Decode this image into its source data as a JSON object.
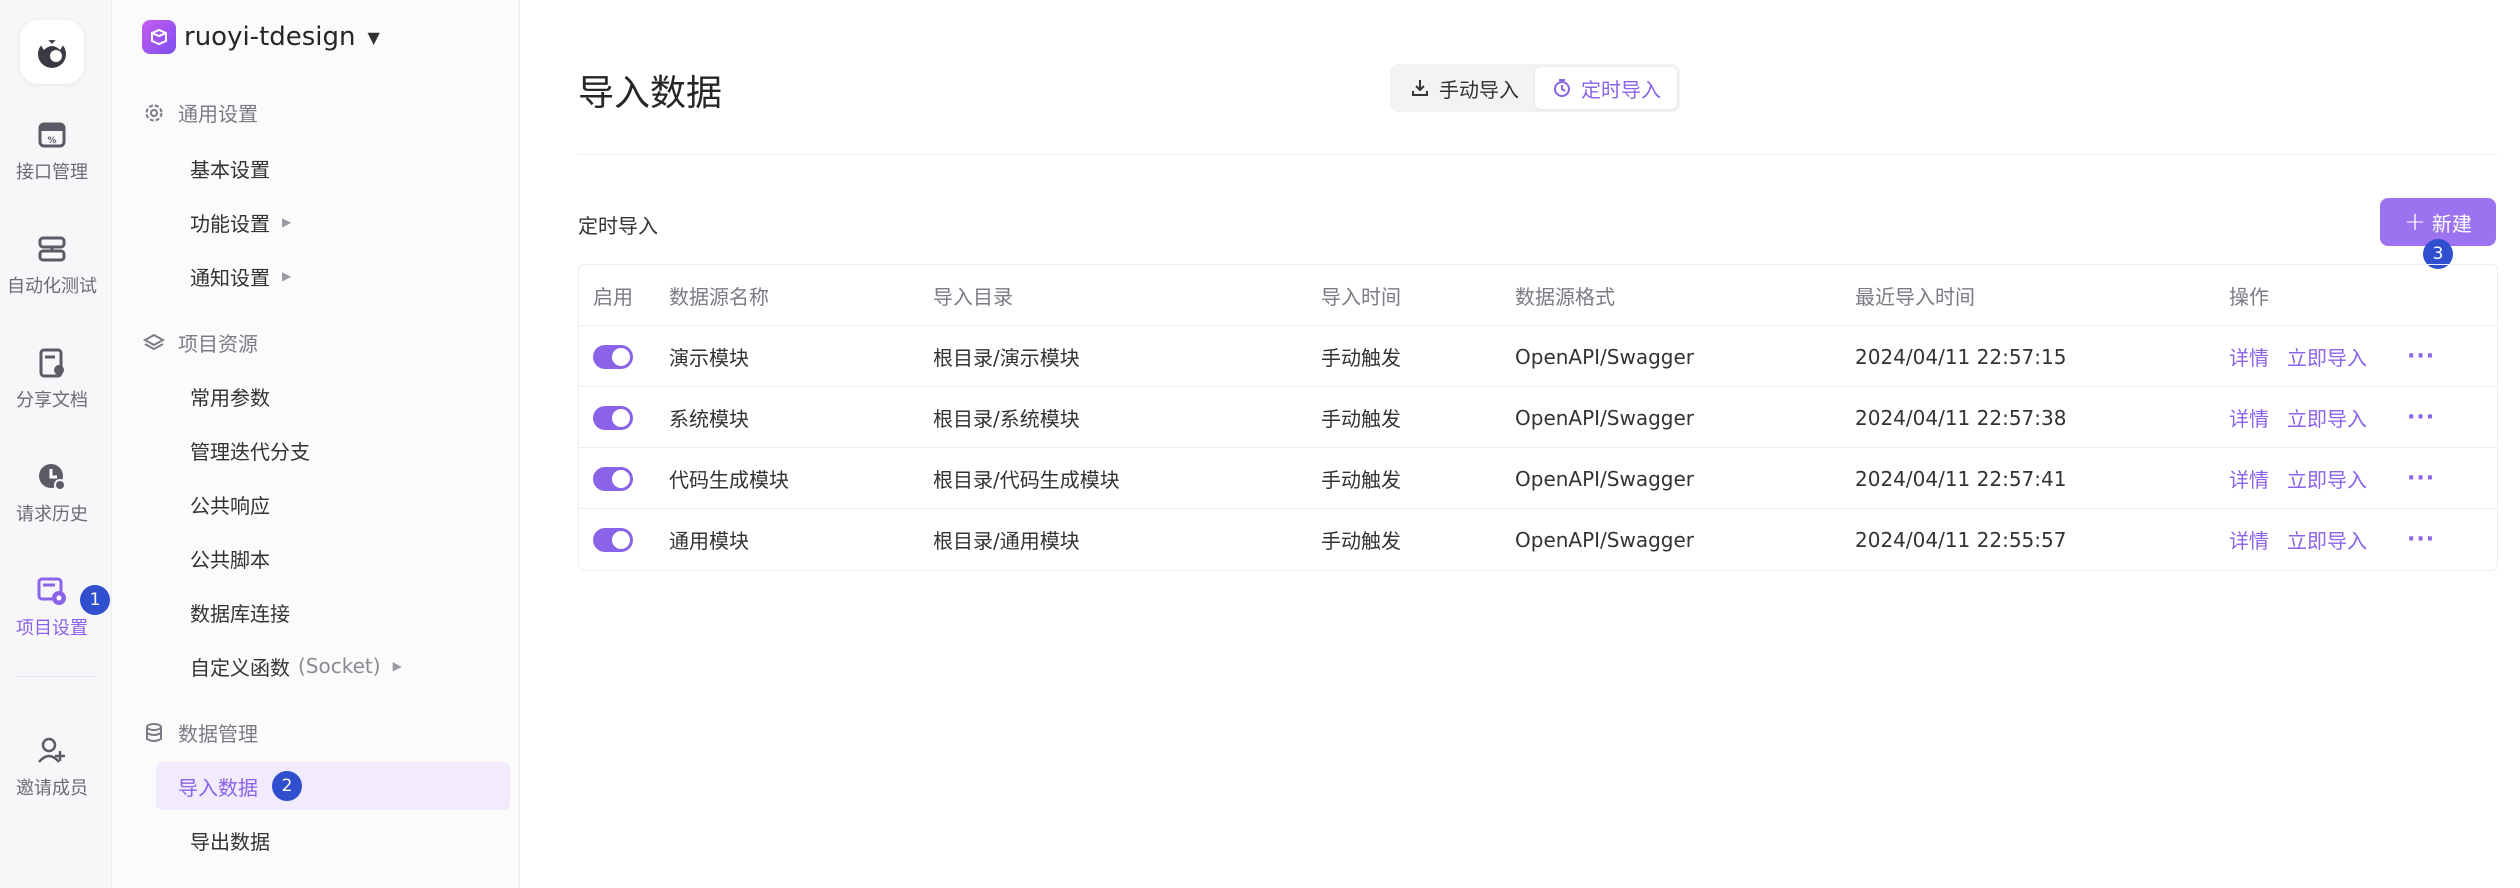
{
  "rail": {
    "items": [
      {
        "label": "接口管理",
        "icon": "api-icon"
      },
      {
        "label": "自动化测试",
        "icon": "automation-icon"
      },
      {
        "label": "分享文档",
        "icon": "share-doc-icon"
      },
      {
        "label": "请求历史",
        "icon": "history-icon"
      },
      {
        "label": "项目设置",
        "icon": "project-settings-icon"
      }
    ],
    "invite_label": "邀请成员",
    "badge_1": "1"
  },
  "project": {
    "name": "ruoyi-tdesign",
    "caret": "▼"
  },
  "sidebar": {
    "groups": [
      {
        "label": "通用设置",
        "icon": "gear-icon"
      },
      {
        "label": "项目资源",
        "icon": "layers-icon"
      },
      {
        "label": "数据管理",
        "icon": "database-icon"
      }
    ],
    "items": [
      {
        "label": "基本设置"
      },
      {
        "label": "功能设置",
        "arrow": "▶"
      },
      {
        "label": "通知设置",
        "arrow": "▶"
      },
      {
        "label": "常用参数"
      },
      {
        "label": "管理迭代分支"
      },
      {
        "label": "公共响应"
      },
      {
        "label": "公共脚本"
      },
      {
        "label": "数据库连接"
      },
      {
        "label": "自定义函数",
        "sub": "(Socket)",
        "arrow": "▶"
      },
      {
        "label": "导入数据"
      },
      {
        "label": "导出数据"
      }
    ],
    "badge_2": "2"
  },
  "main": {
    "title": "导入数据",
    "tabs": [
      {
        "label": "手动导入",
        "icon": "download-icon"
      },
      {
        "label": "定时导入",
        "icon": "timer-icon"
      }
    ],
    "section_label": "定时导入",
    "new_button": {
      "plus": "+",
      "label": "新建"
    },
    "badge_3": "3"
  },
  "table": {
    "headers": [
      "启用",
      "数据源名称",
      "导入目录",
      "导入时间",
      "数据源格式",
      "最近导入时间",
      "操作"
    ],
    "rows": [
      {
        "name": "演示模块",
        "dir": "根目录/演示模块",
        "time": "手动触发",
        "format": "OpenAPI/Swagger",
        "last": "2024/04/11 22:57:15"
      },
      {
        "name": "系统模块",
        "dir": "根目录/系统模块",
        "time": "手动触发",
        "format": "OpenAPI/Swagger",
        "last": "2024/04/11 22:57:38"
      },
      {
        "name": "代码生成模块",
        "dir": "根目录/代码生成模块",
        "time": "手动触发",
        "format": "OpenAPI/Swagger",
        "last": "2024/04/11 22:57:41"
      },
      {
        "name": "通用模块",
        "dir": "根目录/通用模块",
        "time": "手动触发",
        "format": "OpenAPI/Swagger",
        "last": "2024/04/11 22:55:57"
      }
    ],
    "actions": {
      "detail": "详情",
      "import_now": "立即导入",
      "more": "···"
    }
  },
  "colors": {
    "accent": "#8b63e8",
    "badge": "#2f4fce"
  }
}
